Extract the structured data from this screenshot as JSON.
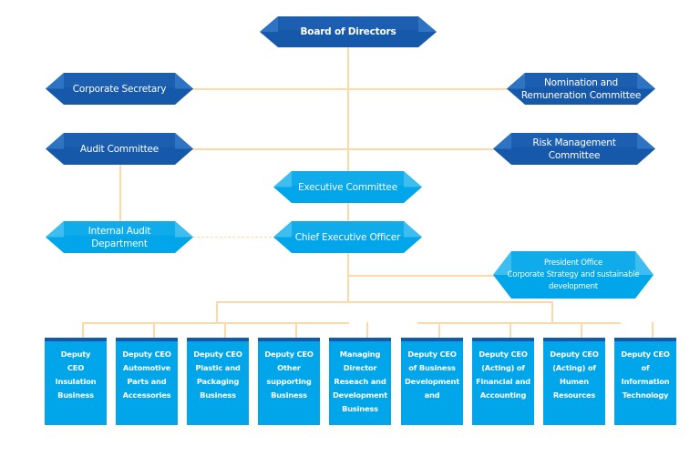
{
  "diagram": {
    "type": "organization-chart",
    "colors": {
      "governance_dark": "#1659aa",
      "governance_light": "#2e74c2",
      "management_dark": "#00a6e9",
      "management_light": "#3dbdf0",
      "connector": "#fcd9a6",
      "unit_top_strip": "#1659aa"
    },
    "nodes": {
      "board": "Board of Directors",
      "corporate_secretary": "Corporate Secretary",
      "nomination": "Nomination and\nRemuneration Committee",
      "audit_committee": "Audit Committee",
      "risk_management": "Risk Management\nCommittee",
      "executive_committee": "Executive Committee",
      "internal_audit": "Internal Audit\nDepartment",
      "ceo": "Chief Executive Officer",
      "president_office": "President Office\nCorporate Strategy and sustainable\ndevelopment"
    },
    "units": [
      "Deputy\nCEO\nInsulation\nBusiness",
      "Deputy CEO\nAutomotive\nParts and\nAccessories",
      "Deputy CEO\nPlastic and\nPackaging\nBusiness",
      "Deputy CEO\nOther\nsupporting\nBusiness",
      "Managing\nDirector\nReseach and\nDevelopment\nBusiness",
      "Deputy CEO\nof Business\nDevelopment\nand",
      "Deputy CEO\n(Acting) of\nFinancial and\nAccounting",
      "Deputy CEO\n(Acting) of\nHumen\nResources",
      "Deputy CEO\nof\nInformation\nTechnology"
    ],
    "edges": [
      {
        "from": "board",
        "to": "corporate_secretary",
        "style": "solid"
      },
      {
        "from": "board",
        "to": "nomination",
        "style": "solid"
      },
      {
        "from": "board",
        "to": "audit_committee",
        "style": "solid"
      },
      {
        "from": "board",
        "to": "risk_management",
        "style": "solid"
      },
      {
        "from": "board",
        "to": "executive_committee",
        "style": "solid"
      },
      {
        "from": "executive_committee",
        "to": "ceo",
        "style": "solid"
      },
      {
        "from": "audit_committee",
        "to": "internal_audit",
        "style": "solid"
      },
      {
        "from": "internal_audit",
        "to": "ceo",
        "style": "dashed"
      },
      {
        "from": "ceo",
        "to": "president_office",
        "style": "solid"
      },
      {
        "from": "ceo",
        "to": "units",
        "style": "solid"
      }
    ]
  }
}
